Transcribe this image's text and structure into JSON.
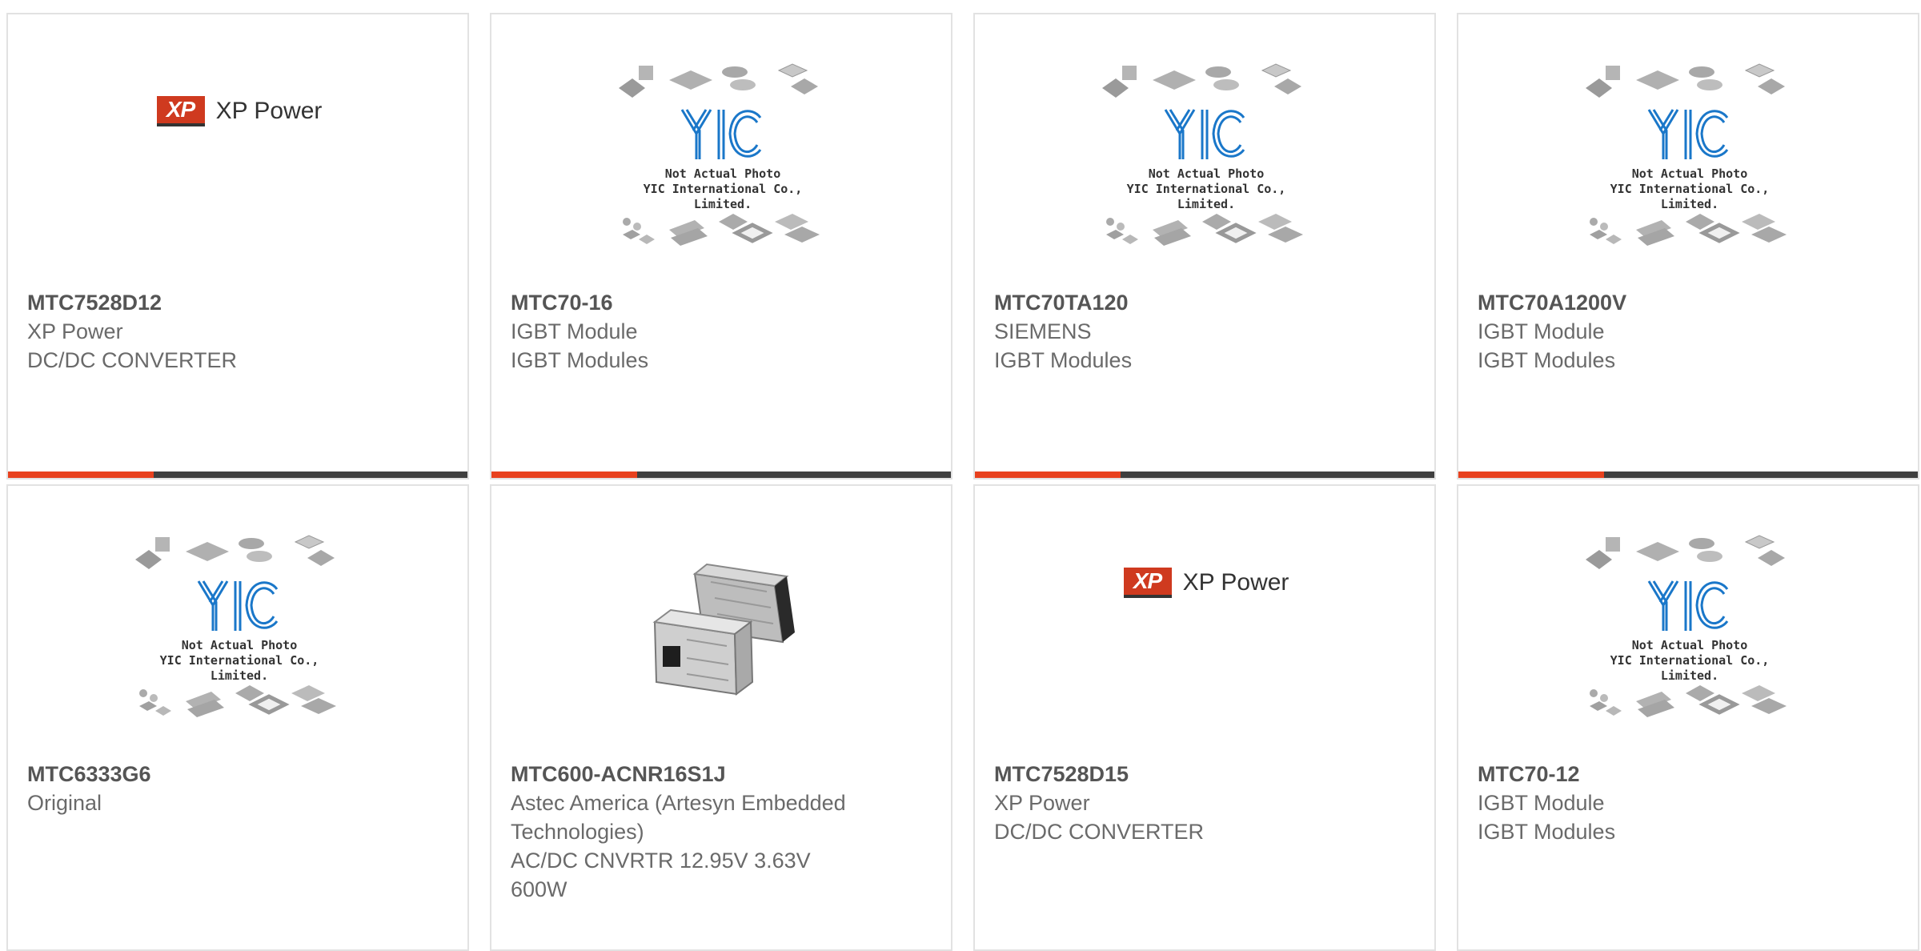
{
  "products": [
    {
      "part_number": "MTC7528D12",
      "lines": [
        "XP Power",
        "DC/DC CONVERTER"
      ],
      "image": "xp-power-logo",
      "logo_text": "XP Power"
    },
    {
      "part_number": "MTC70-16",
      "lines": [
        "IGBT Module",
        "IGBT Modules"
      ],
      "image": "yic-placeholder"
    },
    {
      "part_number": "MTC70TA120",
      "lines": [
        "SIEMENS",
        "IGBT Modules"
      ],
      "image": "yic-placeholder"
    },
    {
      "part_number": "MTC70A1200V",
      "lines": [
        "IGBT Module",
        "IGBT Modules"
      ],
      "image": "yic-placeholder"
    },
    {
      "part_number": "MTC6333G6",
      "lines": [
        "Original"
      ],
      "image": "yic-placeholder"
    },
    {
      "part_number": "MTC600-ACNR16S1J",
      "lines": [
        "Astec America (Artesyn Embedded Technologies)",
        "AC/DC CNVRTR 12.95V 3.63V 600W"
      ],
      "image": "power-supply-photo"
    },
    {
      "part_number": "MTC7528D15",
      "lines": [
        "XP Power",
        "DC/DC CONVERTER"
      ],
      "image": "xp-power-logo",
      "logo_text": "XP Power"
    },
    {
      "part_number": "MTC70-12",
      "lines": [
        "IGBT Module",
        "IGBT Modules"
      ],
      "image": "yic-placeholder"
    }
  ],
  "placeholder": {
    "logo_text": "YIC",
    "caption_line1": "Not Actual Photo",
    "caption_line2": "YIC International Co., Limited."
  },
  "xp_logo_mark": "XP",
  "colors": {
    "accent": "#e8411e",
    "bar": "#3f3f3f",
    "yic_blue": "#1a77c9",
    "text_primary": "#555555",
    "text_secondary": "#6a6a6a"
  }
}
